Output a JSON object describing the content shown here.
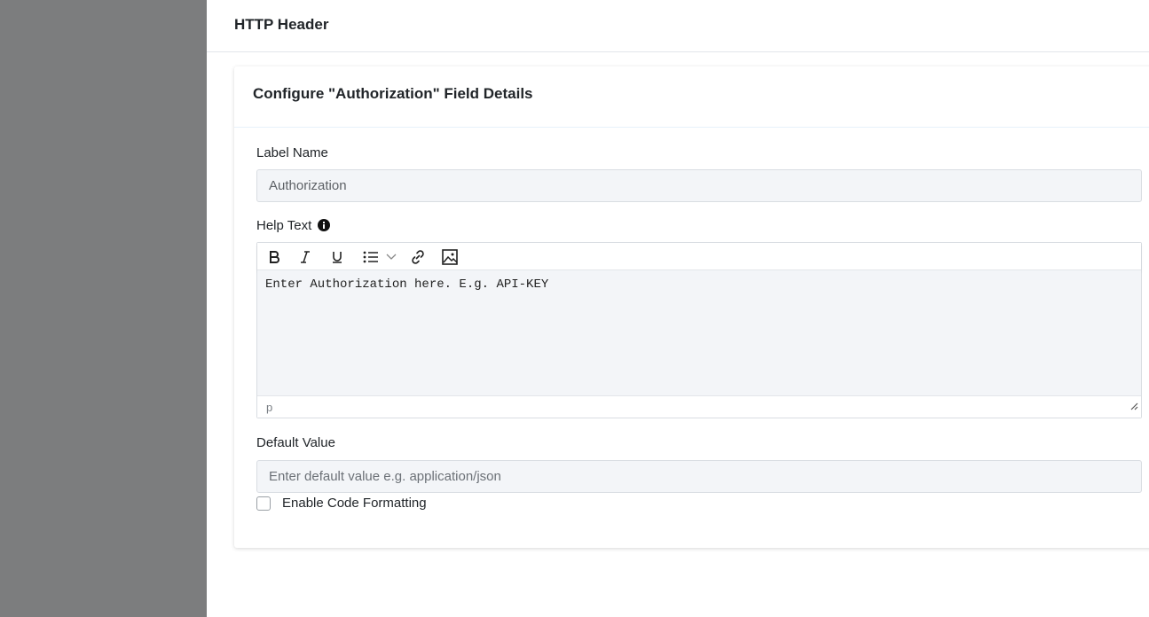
{
  "header": {
    "title": "HTTP Header"
  },
  "card": {
    "title": "Configure \"Authorization\" Field Details"
  },
  "label_name": {
    "label": "Label Name",
    "value": "Authorization"
  },
  "help_text": {
    "label": "Help Text",
    "content": "Enter Authorization here. E.g. API-KEY",
    "status_path": "p",
    "toolbar": [
      "bold-icon",
      "italic-icon",
      "underline-icon",
      "bullet-list-icon",
      "chevron-down-icon",
      "link-icon",
      "image-icon"
    ]
  },
  "default_value": {
    "label": "Default Value",
    "placeholder": "Enter default value e.g. application/json"
  },
  "code_formatting": {
    "label": "Enable Code Formatting",
    "checked": false
  },
  "colors": {
    "sidebar": "#7c7d7e",
    "input_bg": "#f3f5f8",
    "border": "#d9dde2"
  }
}
